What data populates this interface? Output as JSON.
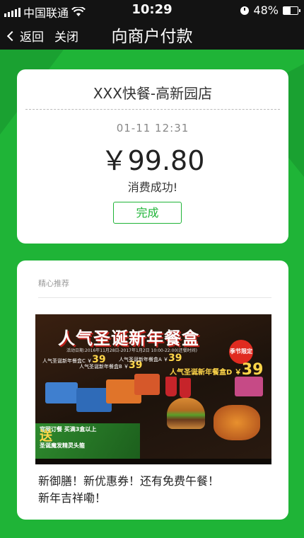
{
  "status_bar": {
    "carrier": "中国联通",
    "time": "10:29",
    "battery_percent": "48%",
    "battery_level": 0.48
  },
  "nav": {
    "back_label": "返回",
    "close_label": "关闭",
    "title": "向商户付款"
  },
  "receipt": {
    "merchant": "XXX快餐-高新园店",
    "datetime": "01-11 12:31",
    "amount": "￥99.80",
    "status": "消费成功!",
    "done_label": "完成"
  },
  "recommend": {
    "title": "精心推荐",
    "banner": {
      "headline": "人气圣诞新年餐盒",
      "dates": "活动日期:2016年11月28日-2017年1月2日 10:00-22:00(还餐时间)",
      "badge": "季节限定",
      "combo_label": "人气圣诞新年餐盒D ￥",
      "combo_price": "39",
      "prices": [
        {
          "label": "人气圣诞新年餐盒C ￥",
          "value": "39"
        },
        {
          "label": "人气圣诞新年餐盒B ￥",
          "value": "39"
        },
        {
          "label": "人气圣诞新年餐盒A ￥",
          "value": "39"
        }
      ],
      "promo_line1": "官网订餐 买满3盒以上",
      "promo_big": "送",
      "promo_line2": "圣诞魔发精灵头箍"
    },
    "description_line1": "新御膳！新优惠券！还有免费午餐！",
    "description_line2": "新年吉祥嘞！"
  },
  "colors": {
    "background": "#1fb437",
    "topbar": "#131313",
    "accent": "#1fb437"
  },
  "icons": [
    "signal-icon",
    "wifi-icon",
    "clock-icon",
    "battery-icon",
    "chevron-left-icon"
  ]
}
